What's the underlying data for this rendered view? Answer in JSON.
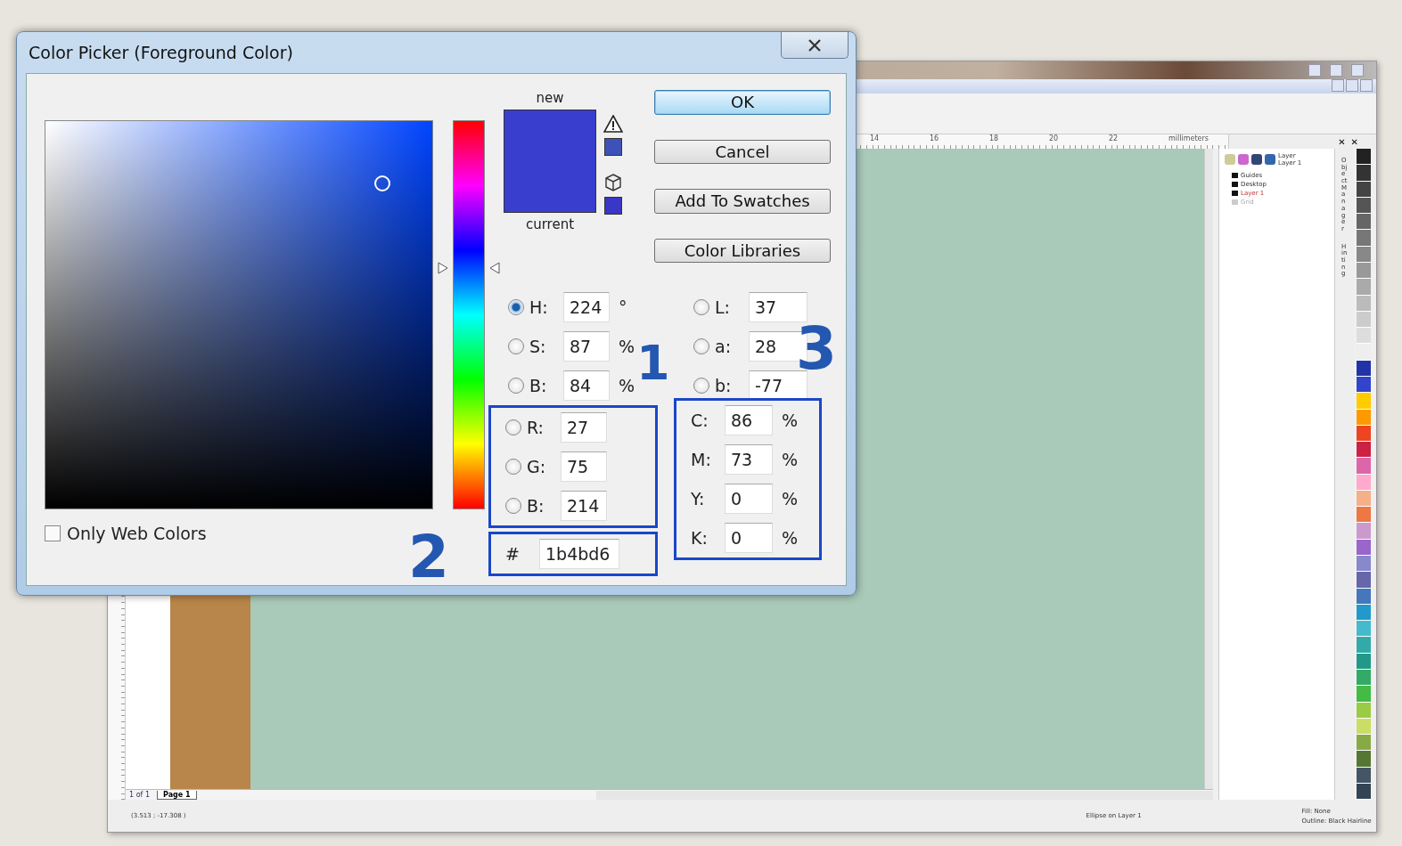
{
  "app": {
    "ruler_labels": [
      "14",
      "16",
      "18",
      "20",
      "22",
      "millimeters"
    ],
    "docker": {
      "header": [
        "Layer",
        "Layer 1"
      ],
      "layers": [
        {
          "name": "Guides",
          "active": false,
          "disabled": false
        },
        {
          "name": "Desktop",
          "active": false,
          "disabled": false
        },
        {
          "name": "Layer 1",
          "active": true,
          "disabled": false
        },
        {
          "name": "Grid",
          "active": false,
          "disabled": true
        }
      ],
      "tabs": [
        "Object Manager",
        "Hinting"
      ]
    },
    "docker_controls": [
      "✕",
      "✕"
    ],
    "page_nav": {
      "position": "1 of 1",
      "page_tab": "Page 1"
    },
    "status": {
      "coordinates": "(3.513 ; -17.308 )",
      "selection": "Ellipse on Layer 1",
      "fill": "Fill: None",
      "outline": "Outline: Black  Hairline"
    }
  },
  "dialog": {
    "title": "Color Picker (Foreground Color)",
    "hue_slider": {
      "level": 0.622
    },
    "swatches": [
      {
        "label": "new",
        "color": "#3a3ecf"
      },
      {
        "label": "current",
        "color": "#3a3ecf"
      }
    ],
    "gamut": [
      {
        "kind": "warning",
        "color": "#3d52b8"
      },
      {
        "kind": "web",
        "color": "#3a36c6"
      }
    ],
    "buttons": [
      {
        "label": "OK",
        "default": true
      },
      {
        "label": "Cancel",
        "default": false
      },
      {
        "label": "Add To Swatches",
        "default": false
      },
      {
        "label": "Color Libraries",
        "default": false
      }
    ],
    "hsb": [
      {
        "label": "H:",
        "value": "224",
        "unit": "°",
        "selected": true
      },
      {
        "label": "S:",
        "value": "87",
        "unit": "%",
        "selected": false
      },
      {
        "label": "B:",
        "value": "84",
        "unit": "%",
        "selected": false
      }
    ],
    "rgb": [
      {
        "label": "R:",
        "value": "27",
        "selected": false
      },
      {
        "label": "G:",
        "value": "75",
        "selected": false
      },
      {
        "label": "B:",
        "value": "214",
        "selected": false
      }
    ],
    "hex": {
      "label": "#",
      "value": "1b4bd6"
    },
    "lab": [
      {
        "label": "L:",
        "value": "37",
        "selected": false
      },
      {
        "label": "a:",
        "value": "28",
        "selected": false
      },
      {
        "label": "b:",
        "value": "-77",
        "selected": false
      }
    ],
    "cmyk": [
      {
        "label": "C:",
        "value": "86",
        "unit": "%"
      },
      {
        "label": "M:",
        "value": "73",
        "unit": "%"
      },
      {
        "label": "Y:",
        "value": "0",
        "unit": "%"
      },
      {
        "label": "K:",
        "value": "0",
        "unit": "%"
      }
    ],
    "only_web_colors": {
      "label": "Only Web Colors",
      "checked": false
    },
    "annotations": [
      "1",
      "2",
      "3"
    ]
  }
}
